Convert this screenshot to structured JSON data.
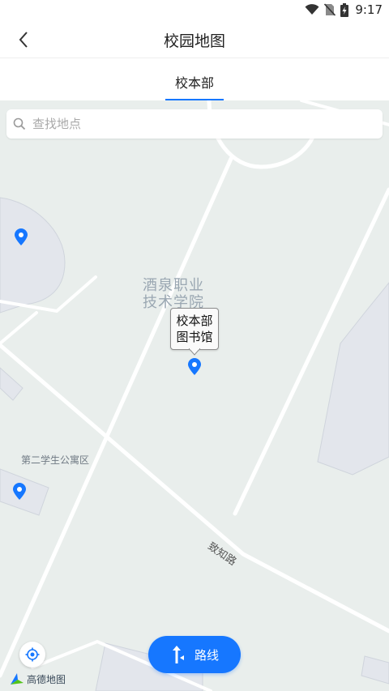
{
  "status_bar": {
    "time": "9:17",
    "icons": [
      "wifi-icon",
      "no-sim-icon",
      "battery-charging-icon"
    ]
  },
  "app_bar": {
    "title": "校园地图",
    "back_icon": "chevron-left-icon"
  },
  "tabs": [
    {
      "label": "校本部",
      "selected": true
    }
  ],
  "search": {
    "placeholder": "查找地点",
    "value": ""
  },
  "map": {
    "campus_label_line1": "酒泉职业",
    "campus_label_line2": "技术学院",
    "dorm_area_label": "第二学生公寓区",
    "road_label": "致知路",
    "callout_line1": "校本部",
    "callout_line2": "图书馆",
    "logo_text": "高德地图",
    "marker_icon": "map-pin-icon",
    "colors": {
      "accent": "#1677ff",
      "background": "#e9eeec",
      "building": "#e3e6ec",
      "road": "#ffffff"
    }
  },
  "route_button": {
    "label": "路线",
    "icon": "route-arrow-icon"
  }
}
